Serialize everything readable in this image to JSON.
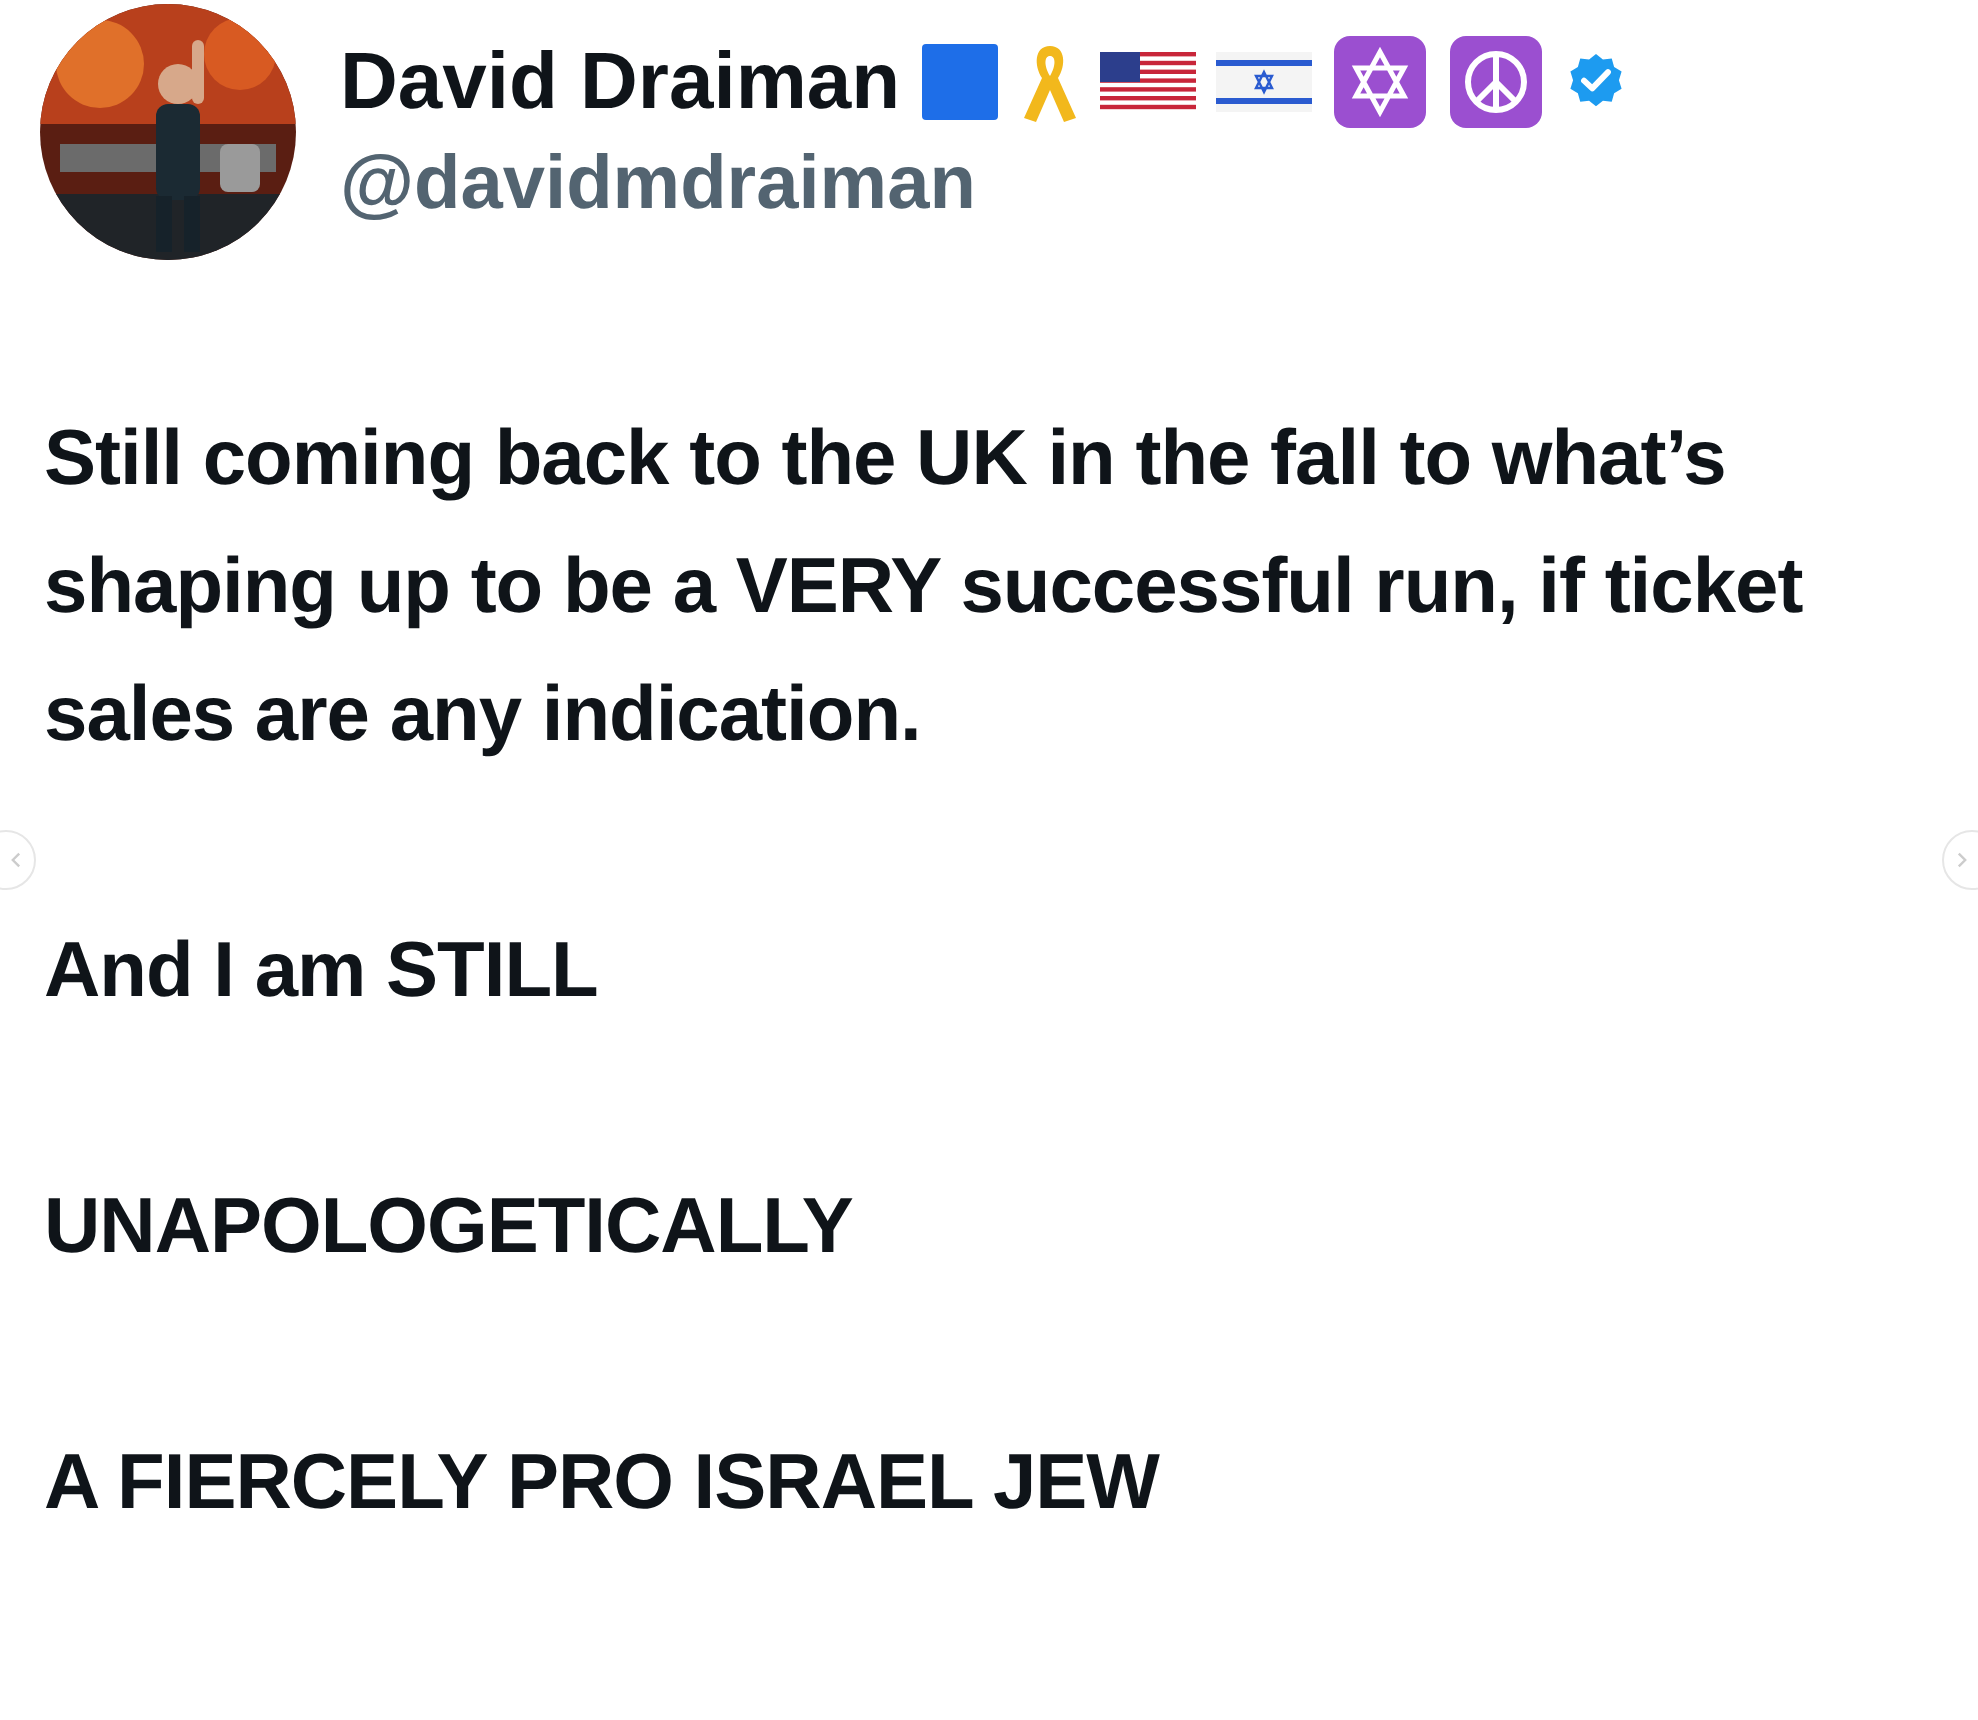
{
  "author": {
    "name": "David Draiman",
    "handle": "@davidmdraiman",
    "verified": true
  },
  "paragraphs": [
    "Still coming back to the UK in the fall to what’s shaping up to be a VERY successful run, if ticket sales are any indication.",
    "And I am STILL",
    "UNAPOLOGETICALLY",
    "A FIERCELY PRO ISRAEL JEW"
  ]
}
